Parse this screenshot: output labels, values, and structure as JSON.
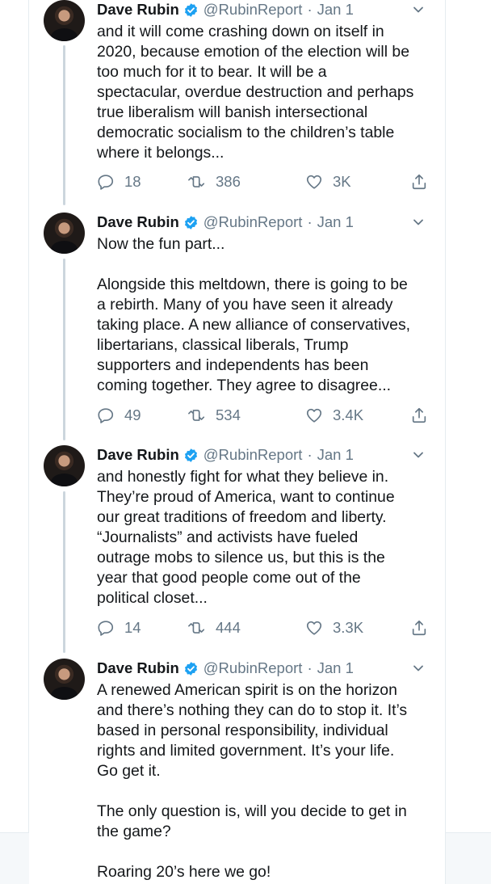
{
  "tweets": [
    {
      "name": "Dave Rubin",
      "handle": "@RubinReport",
      "date": "Jan 1",
      "text": "and it will come crashing down on itself in\n2020, because emotion of the election will be\ntoo much for it to bear. It will be a\nspectacular, overdue destruction and perhaps\ntrue liberalism will banish intersectional\ndemocratic socialism to the children’s table\nwhere it belongs...",
      "replies": "18",
      "retweets": "386",
      "likes": "3K"
    },
    {
      "name": "Dave Rubin",
      "handle": "@RubinReport",
      "date": "Jan 1",
      "text": "Now the fun part...\n\nAlongside this meltdown, there is going to be\na rebirth. Many of you have seen it already\ntaking place. A new alliance of conservatives,\nlibertarians, classical liberals, Trump\nsupporters and independents has been\ncoming together. They agree to disagree...",
      "replies": "49",
      "retweets": "534",
      "likes": "3.4K"
    },
    {
      "name": "Dave Rubin",
      "handle": "@RubinReport",
      "date": "Jan 1",
      "text": "and honestly fight for what they believe in.\nThey’re proud of America, want to continue\nour great traditions of freedom and liberty.\n“Journalists” and activists have fueled\noutrage mobs to silence us, but this is the\nyear that good people come out of the\npolitical closet...",
      "replies": "14",
      "retweets": "444",
      "likes": "3.3K"
    },
    {
      "name": "Dave Rubin",
      "handle": "@RubinReport",
      "date": "Jan 1",
      "text": "A renewed American spirit is on the horizon\nand there’s nothing they can do to stop it. It’s\nbased in personal responsibility, individual\nrights and limited government. It’s your life.\nGo get it.\n\nThe only question is, will you decide to get in\nthe game?\n\nRoaring 20’s here we go!"
    }
  ],
  "icons": {
    "verified": "verified-badge-icon",
    "caret": "chevron-down-icon",
    "reply": "reply-icon",
    "retweet": "retweet-icon",
    "like": "heart-icon",
    "share": "share-icon"
  },
  "colors": {
    "verified": "#1da1f2",
    "secondary_text": "#657786",
    "thread_line": "#ccd6dd"
  }
}
